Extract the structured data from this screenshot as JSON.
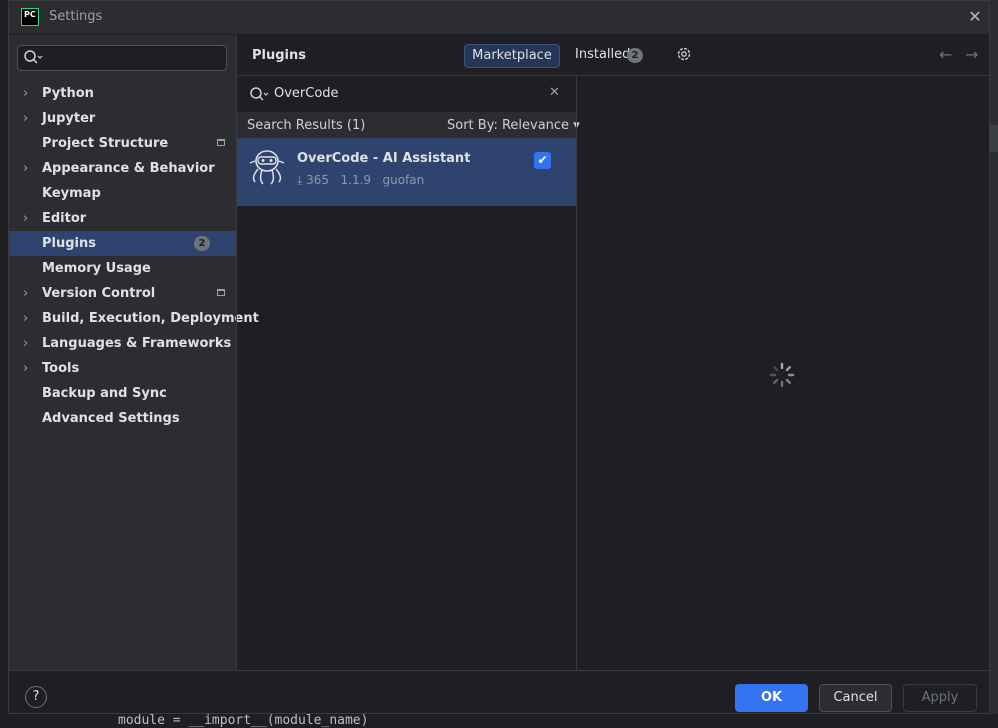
{
  "window": {
    "title": "Settings",
    "app_logo_text": "PC",
    "close_glyph": "✕"
  },
  "sidebar": {
    "search_placeholder": "",
    "items": [
      {
        "label": "Python",
        "expandable": true
      },
      {
        "label": "Jupyter",
        "expandable": true
      },
      {
        "label": "Project Structure",
        "expandable": false,
        "project_icon": true
      },
      {
        "label": "Appearance & Behavior",
        "expandable": true
      },
      {
        "label": "Keymap",
        "expandable": false
      },
      {
        "label": "Editor",
        "expandable": true
      },
      {
        "label": "Plugins",
        "expandable": false,
        "selected": true,
        "badge": "2"
      },
      {
        "label": "Memory Usage",
        "expandable": false
      },
      {
        "label": "Version Control",
        "expandable": true,
        "project_icon": true
      },
      {
        "label": "Build, Execution, Deployment",
        "expandable": true
      },
      {
        "label": "Languages & Frameworks",
        "expandable": true
      },
      {
        "label": "Tools",
        "expandable": true
      },
      {
        "label": "Backup and Sync",
        "expandable": false
      },
      {
        "label": "Advanced Settings",
        "expandable": false
      }
    ]
  },
  "header": {
    "title": "Plugins",
    "tabs": {
      "marketplace": "Marketplace",
      "installed": "Installed",
      "installed_badge": "2"
    }
  },
  "plugin_search": {
    "value": "OverCode",
    "results_label": "Search Results (1)",
    "sort_label": "Sort By: Relevance ▾"
  },
  "results": [
    {
      "name": "OverCode - AI Assistant",
      "downloads": "365",
      "version": "1.1.9",
      "vendor": "guofan",
      "checked": true
    }
  ],
  "footer": {
    "help": "?",
    "ok": "OK",
    "cancel": "Cancel",
    "apply": "Apply"
  },
  "background_code": "module = __import__(module_name)",
  "colors": {
    "accent": "#3574f0",
    "selection": "#2e436e",
    "panel": "#2b2d30",
    "background": "#1e1f22"
  }
}
